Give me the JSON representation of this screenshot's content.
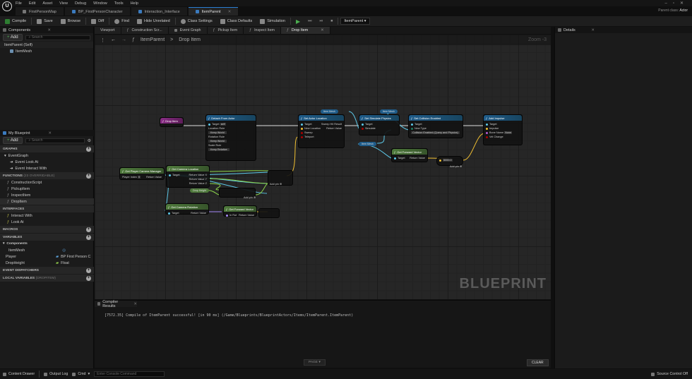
{
  "menu": [
    "File",
    "Edit",
    "Asset",
    "View",
    "Debug",
    "Window",
    "Tools",
    "Help"
  ],
  "tabs": [
    "FirstPersonMap",
    "BP_FirstPersonCharacter",
    "Interaction_Interface",
    "ItemParent"
  ],
  "parent_class": {
    "label": "Parent class:",
    "value": "Actor"
  },
  "toolbar": {
    "compile": "Compile",
    "save": "Save",
    "browse": "Browse",
    "diff": "Diff",
    "find": "Find",
    "hide_unrelated": "Hide Unrelated",
    "class_settings": "Class Settings",
    "class_defaults": "Class Defaults",
    "simulation": "Simulation",
    "debug_object": "ItemParent"
  },
  "components": {
    "title": "Components",
    "add": "Add",
    "search_placeholder": "Search",
    "root": "ItemParent (Self)",
    "child": "ItemMesh"
  },
  "blueprint": {
    "title": "My Blueprint",
    "add": "Add",
    "search_placeholder": "Search",
    "graphs_label": "GRAPHS",
    "event_graph": "EventGraph",
    "events": [
      "Event Look At",
      "Event Interact With"
    ],
    "functions_label": "FUNCTIONS",
    "functions_count": "(23 OVERRIDABLE)",
    "functions": [
      "ConstructionScript",
      "PickupItem",
      "InspectItem",
      "DropItem"
    ],
    "interfaces_label": "INTERFACES",
    "interfaces": [
      "Interact With",
      "Look At"
    ],
    "macros_label": "MACROS",
    "variables_label": "VARIABLES",
    "components_label": "Components",
    "variables": [
      {
        "name": "ItemMesh",
        "type": ""
      },
      {
        "name": "Player",
        "type": "BP First Person C"
      },
      {
        "name": "DropHeight",
        "type": "Float"
      }
    ],
    "dispatchers_label": "EVENT DISPATCHERS",
    "locals_label": "LOCAL VARIABLES",
    "locals_scope": "(DROPITEM)"
  },
  "graph_tabs": [
    "Viewport",
    "Construction Scr...",
    "Event Graph",
    "Pickup Item",
    "Inspect Item",
    "Drop Item"
  ],
  "graph": {
    "crumb_root": "ItemParent",
    "crumb_sep": ">",
    "crumb_leaf": "Drop Item",
    "zoom": "Zoom -3",
    "watermark": "BLUEPRINT"
  },
  "nodes": {
    "drop_item": "Drop Item",
    "detach": {
      "title": "Detach From Actor",
      "target": "Target",
      "target_val": "self",
      "loc": "Location Rule",
      "loc_val": "Keep World",
      "rot": "Rotation Rule",
      "rot_val": "Keep World",
      "scale": "Scale Rule",
      "scale_val": "Keep Relative"
    },
    "set_loc": {
      "title": "Set Actor Location",
      "target": "Target",
      "new_loc": "New Location",
      "sweep": "Sweep",
      "teleport": "Teleport",
      "sweep_hit": "Sweep Hit Result",
      "ret": "Return Value"
    },
    "sim_phys": {
      "title": "Set Simulate Physics",
      "target": "Target",
      "simulate": "Simulate"
    },
    "collision": {
      "title": "Set Collision Enabled",
      "target": "Target",
      "new_type": "New Type",
      "type_val": "Collision Enabled (Query and Physics)"
    },
    "impulse": {
      "title": "Add Impulse",
      "target": "Target",
      "impulse": "Impulse",
      "bone": "Bone Name",
      "bone_val": "None",
      "vel": "Vel Change"
    },
    "cam_mgr": {
      "title": "Get Player Camera Manager",
      "idx": "Player Index",
      "idx_val": "0",
      "ret": "Return Value"
    },
    "cam_loc": {
      "title": "Get Camera Location",
      "target": "Target",
      "rets": [
        "Return Value X",
        "Return Value Y",
        "Return Value Z"
      ]
    },
    "cam_rot": {
      "title": "Get Camera Rotation",
      "target": "Target",
      "ret": "Return Value"
    },
    "fwd": {
      "title": "Get Forward Vector",
      "in": "In Rot",
      "ret": "Return Value"
    },
    "fwd2": {
      "title": "Get Forward Vector",
      "target": "Target",
      "ret": "Return Value"
    },
    "drop_height": "Drop Height",
    "add_pin": "Add pin",
    "item_mesh": "Item Mesh",
    "mult_val": "5000.0"
  },
  "details": {
    "title": "Details"
  },
  "compiler": {
    "title": "Compiler Results",
    "log": "[7572.35] Compile of ItemParent successful! [in 90 ms] (/Game/Blueprints/BlueprintActors/Items/ItemParent.ItemParent)",
    "page": "PAGE",
    "clear": "CLEAR"
  },
  "status": {
    "drawer": "Content Drawer",
    "output": "Output Log",
    "cmd": "Cmd",
    "cmd_placeholder": "Enter Console Command",
    "source": "Source Control Off"
  }
}
